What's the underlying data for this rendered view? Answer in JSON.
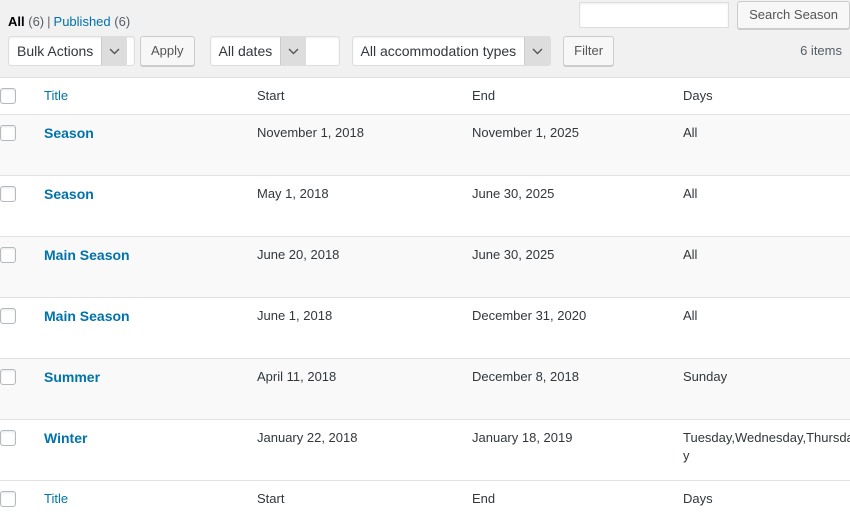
{
  "views": {
    "all_label": "All",
    "all_count": "(6)",
    "separator": "|",
    "published_label": "Published",
    "published_count": "(6)"
  },
  "search": {
    "value": "",
    "placeholder": "",
    "button_label": "Search Season"
  },
  "filters": {
    "bulk_actions_label": "Bulk Actions",
    "apply_label": "Apply",
    "dates_label": "All dates",
    "types_label": "All accommodation types",
    "filter_label": "Filter"
  },
  "pagination": {
    "displaying_num": "6 items"
  },
  "table": {
    "columns": {
      "title": "Title",
      "start": "Start",
      "end": "End",
      "days": "Days"
    },
    "rows": [
      {
        "title": "Season",
        "start": "November 1, 2018",
        "end": "November 1, 2025",
        "days": "All"
      },
      {
        "title": "Season",
        "start": "May 1, 2018",
        "end": "June 30, 2025",
        "days": "All"
      },
      {
        "title": "Main Season",
        "start": "June 20, 2018",
        "end": "June 30, 2025",
        "days": "All"
      },
      {
        "title": "Main Season",
        "start": "June 1, 2018",
        "end": "December 31, 2020",
        "days": "All"
      },
      {
        "title": "Summer",
        "start": "April 11, 2018",
        "end": "December 8, 2018",
        "days": "Sunday"
      },
      {
        "title": "Winter",
        "start": "January 22, 2018",
        "end": "January 18, 2019",
        "days": "Tuesday,Wednesday,Thursday,Friday"
      }
    ]
  },
  "colors": {
    "link": "#0073aa",
    "page_bg": "#f1f1f1",
    "row_alt_bg": "#f9f9f9",
    "border": "#e1e1e1"
  }
}
